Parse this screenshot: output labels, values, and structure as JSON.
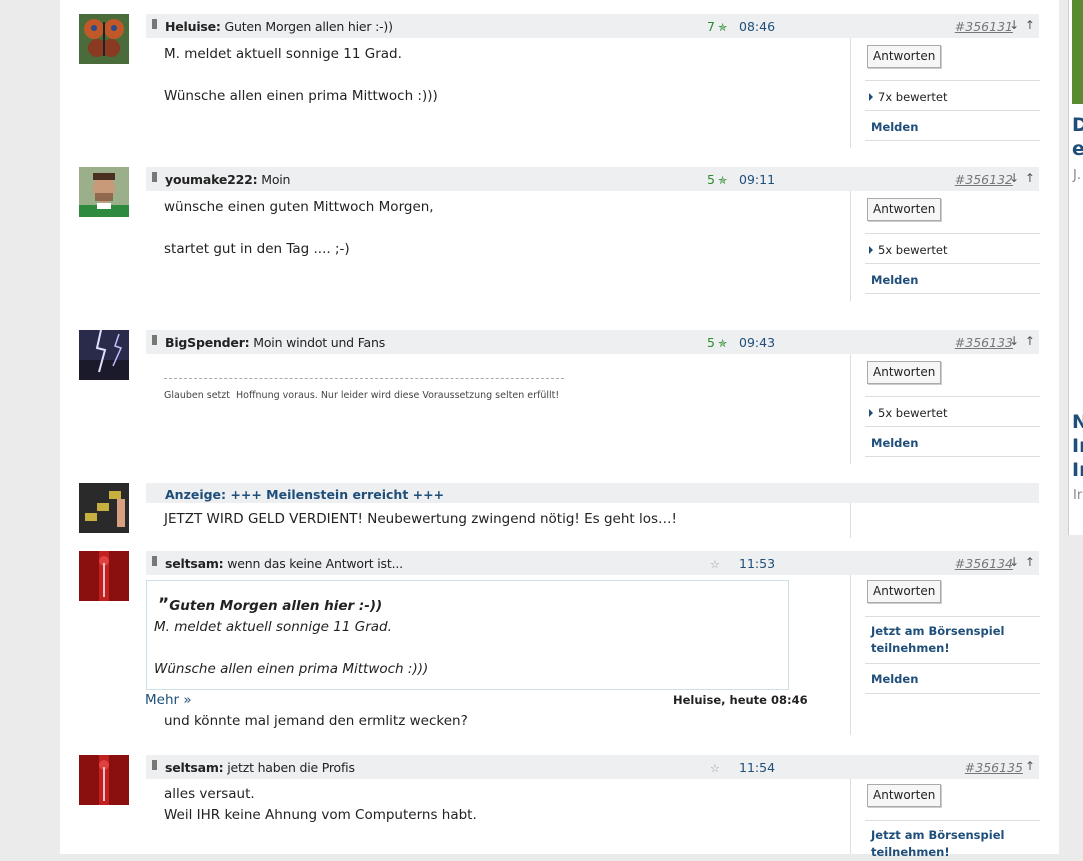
{
  "posts": [
    {
      "author": "Heluise:",
      "subject": "Guten Morgen allen hier :-))",
      "votes": "7",
      "time": "08:46",
      "id": "#356131",
      "arrows": "↓ ↑",
      "body": "M. meldet aktuell sonnige 11 Grad.\n\nWünsche allen einen prima Mittwoch :)))",
      "reply": "Antworten",
      "rated": "7x bewertet",
      "report": "Melden"
    },
    {
      "author": "youmake222:",
      "subject": "Moin",
      "votes": "5",
      "time": "09:11",
      "id": "#356132",
      "arrows": "↓ ↑",
      "body": "wünsche einen guten Mittwoch Morgen,\n\nstartet gut in den Tag ....  ;-)",
      "reply": "Antworten",
      "rated": "5x bewertet",
      "report": "Melden"
    },
    {
      "author": "BigSpender:",
      "subject": "Moin windot und Fans",
      "votes": "5",
      "time": "09:43",
      "id": "#356133",
      "arrows": "↓ ↑",
      "signature": "Glauben setzt  Hoffnung voraus. Nur leider wird diese Voraussetzung selten erfüllt!",
      "reply": "Antworten",
      "rated": "5x bewertet",
      "report": "Melden"
    },
    {
      "author": "seltsam:",
      "subject": "wenn das keine Antwort ist...",
      "time": "11:53",
      "id": "#356134",
      "arrows": "↓ ↑",
      "quote_title": "Guten Morgen allen hier :-))",
      "quote_body": "M. meldet aktuell sonnige 11 Grad.\n\nWünsche allen einen prima Mittwoch :)))",
      "more": "Mehr »",
      "quote_source": "Heluise, heute 08:46",
      "body": "und könnte mal jemand den ermlitz wecken?",
      "reply": "Antworten",
      "game": "Jetzt am Börsenspiel teilnehmen!",
      "report": "Melden"
    },
    {
      "author": "seltsam:",
      "subject": "jetzt haben die Profis",
      "time": "11:54",
      "id": "#356135",
      "arrows": "↑",
      "body": "alles versaut.\nWeil IHR keine Ahnung vom Computerns habt.",
      "reply": "Antworten",
      "game": "Jetzt am Börsenspiel teilnehmen!"
    }
  ],
  "ad": {
    "title": "Anzeige: +++ Meilenstein erreicht +++",
    "body": "JETZT WIRD GELD VERDIENT! Neubewertung zwingend nötig! Es geht los…!"
  },
  "right_column": {
    "t1": "D",
    "t2": "e",
    "t3": "J.",
    "t4": "N",
    "t5": "In",
    "t6": "In",
    "t7": "Ir"
  },
  "colors": {
    "accent": "#1e4e79",
    "vote": "#2e8b2e",
    "header_bg": "#edeff1"
  }
}
